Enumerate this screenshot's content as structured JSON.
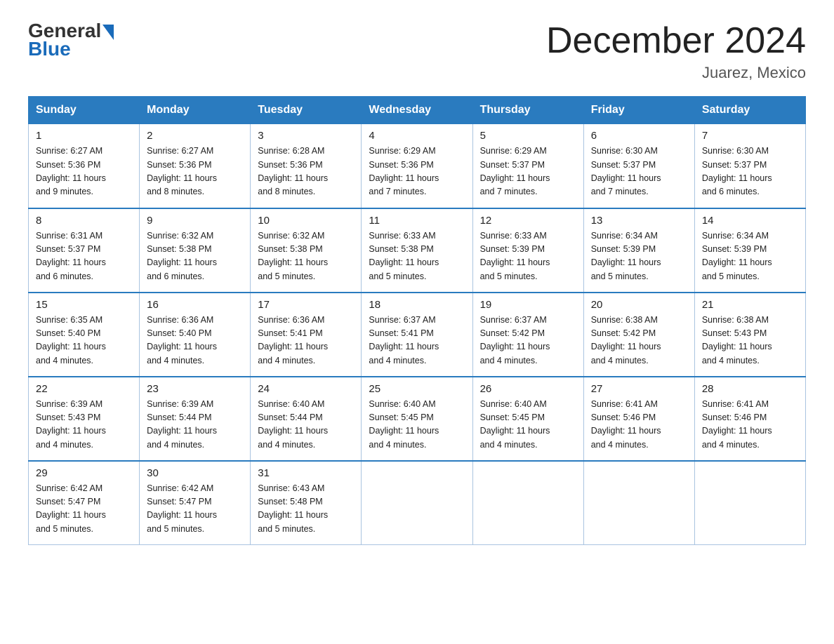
{
  "logo": {
    "general": "General",
    "blue": "Blue",
    "triangle_color": "#1a6bba"
  },
  "title": "December 2024",
  "location": "Juarez, Mexico",
  "days_of_week": [
    "Sunday",
    "Monday",
    "Tuesday",
    "Wednesday",
    "Thursday",
    "Friday",
    "Saturday"
  ],
  "weeks": [
    [
      {
        "day": "1",
        "sunrise": "6:27 AM",
        "sunset": "5:36 PM",
        "daylight": "11 hours and 9 minutes."
      },
      {
        "day": "2",
        "sunrise": "6:27 AM",
        "sunset": "5:36 PM",
        "daylight": "11 hours and 8 minutes."
      },
      {
        "day": "3",
        "sunrise": "6:28 AM",
        "sunset": "5:36 PM",
        "daylight": "11 hours and 8 minutes."
      },
      {
        "day": "4",
        "sunrise": "6:29 AM",
        "sunset": "5:36 PM",
        "daylight": "11 hours and 7 minutes."
      },
      {
        "day": "5",
        "sunrise": "6:29 AM",
        "sunset": "5:37 PM",
        "daylight": "11 hours and 7 minutes."
      },
      {
        "day": "6",
        "sunrise": "6:30 AM",
        "sunset": "5:37 PM",
        "daylight": "11 hours and 7 minutes."
      },
      {
        "day": "7",
        "sunrise": "6:30 AM",
        "sunset": "5:37 PM",
        "daylight": "11 hours and 6 minutes."
      }
    ],
    [
      {
        "day": "8",
        "sunrise": "6:31 AM",
        "sunset": "5:37 PM",
        "daylight": "11 hours and 6 minutes."
      },
      {
        "day": "9",
        "sunrise": "6:32 AM",
        "sunset": "5:38 PM",
        "daylight": "11 hours and 6 minutes."
      },
      {
        "day": "10",
        "sunrise": "6:32 AM",
        "sunset": "5:38 PM",
        "daylight": "11 hours and 5 minutes."
      },
      {
        "day": "11",
        "sunrise": "6:33 AM",
        "sunset": "5:38 PM",
        "daylight": "11 hours and 5 minutes."
      },
      {
        "day": "12",
        "sunrise": "6:33 AM",
        "sunset": "5:39 PM",
        "daylight": "11 hours and 5 minutes."
      },
      {
        "day": "13",
        "sunrise": "6:34 AM",
        "sunset": "5:39 PM",
        "daylight": "11 hours and 5 minutes."
      },
      {
        "day": "14",
        "sunrise": "6:34 AM",
        "sunset": "5:39 PM",
        "daylight": "11 hours and 5 minutes."
      }
    ],
    [
      {
        "day": "15",
        "sunrise": "6:35 AM",
        "sunset": "5:40 PM",
        "daylight": "11 hours and 4 minutes."
      },
      {
        "day": "16",
        "sunrise": "6:36 AM",
        "sunset": "5:40 PM",
        "daylight": "11 hours and 4 minutes."
      },
      {
        "day": "17",
        "sunrise": "6:36 AM",
        "sunset": "5:41 PM",
        "daylight": "11 hours and 4 minutes."
      },
      {
        "day": "18",
        "sunrise": "6:37 AM",
        "sunset": "5:41 PM",
        "daylight": "11 hours and 4 minutes."
      },
      {
        "day": "19",
        "sunrise": "6:37 AM",
        "sunset": "5:42 PM",
        "daylight": "11 hours and 4 minutes."
      },
      {
        "day": "20",
        "sunrise": "6:38 AM",
        "sunset": "5:42 PM",
        "daylight": "11 hours and 4 minutes."
      },
      {
        "day": "21",
        "sunrise": "6:38 AM",
        "sunset": "5:43 PM",
        "daylight": "11 hours and 4 minutes."
      }
    ],
    [
      {
        "day": "22",
        "sunrise": "6:39 AM",
        "sunset": "5:43 PM",
        "daylight": "11 hours and 4 minutes."
      },
      {
        "day": "23",
        "sunrise": "6:39 AM",
        "sunset": "5:44 PM",
        "daylight": "11 hours and 4 minutes."
      },
      {
        "day": "24",
        "sunrise": "6:40 AM",
        "sunset": "5:44 PM",
        "daylight": "11 hours and 4 minutes."
      },
      {
        "day": "25",
        "sunrise": "6:40 AM",
        "sunset": "5:45 PM",
        "daylight": "11 hours and 4 minutes."
      },
      {
        "day": "26",
        "sunrise": "6:40 AM",
        "sunset": "5:45 PM",
        "daylight": "11 hours and 4 minutes."
      },
      {
        "day": "27",
        "sunrise": "6:41 AM",
        "sunset": "5:46 PM",
        "daylight": "11 hours and 4 minutes."
      },
      {
        "day": "28",
        "sunrise": "6:41 AM",
        "sunset": "5:46 PM",
        "daylight": "11 hours and 4 minutes."
      }
    ],
    [
      {
        "day": "29",
        "sunrise": "6:42 AM",
        "sunset": "5:47 PM",
        "daylight": "11 hours and 5 minutes."
      },
      {
        "day": "30",
        "sunrise": "6:42 AM",
        "sunset": "5:47 PM",
        "daylight": "11 hours and 5 minutes."
      },
      {
        "day": "31",
        "sunrise": "6:43 AM",
        "sunset": "5:48 PM",
        "daylight": "11 hours and 5 minutes."
      },
      null,
      null,
      null,
      null
    ]
  ],
  "labels": {
    "sunrise": "Sunrise:",
    "sunset": "Sunset:",
    "daylight": "Daylight:"
  }
}
